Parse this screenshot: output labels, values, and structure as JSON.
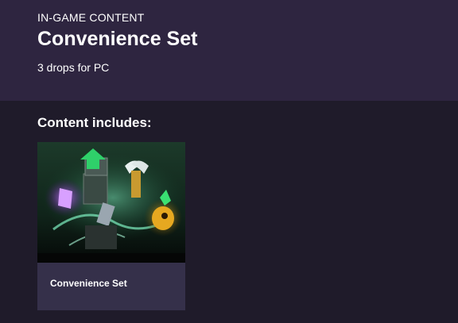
{
  "header": {
    "eyebrow": "IN-GAME CONTENT",
    "title": "Convenience Set",
    "subtitle": "3 drops for PC"
  },
  "content": {
    "heading": "Content includes:",
    "items": [
      {
        "label": "Convenience Set",
        "art_icon": "game-items-artwork"
      }
    ]
  },
  "colors": {
    "background": "#1f1b2a",
    "header_bg": "#2e2540",
    "card_bg": "#35304a",
    "text": "#ffffff"
  }
}
